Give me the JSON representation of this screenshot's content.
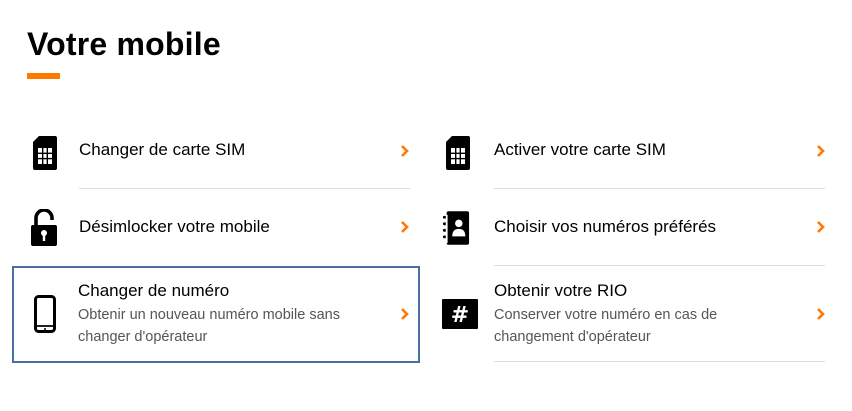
{
  "page": {
    "title": "Votre mobile"
  },
  "colors": {
    "accent": "#ff7900",
    "focus": "#4a6fa5"
  },
  "items": [
    {
      "label": "Changer de carte SIM",
      "icon": "sim-card-icon"
    },
    {
      "label": "Activer votre carte SIM",
      "icon": "sim-card-icon"
    },
    {
      "label": "Désimlocker votre mobile",
      "icon": "unlock-padlock-icon"
    },
    {
      "label": "Choisir vos numéros préférés",
      "icon": "contact-book-icon"
    },
    {
      "label": "Changer de numéro",
      "description": "Obtenir un nouveau numéro mobile sans changer d'opérateur",
      "icon": "smartphone-icon"
    },
    {
      "label": "Obtenir votre RIO",
      "description": "Conserver votre numéro en cas de changement d'opérateur",
      "icon": "hash-icon"
    }
  ]
}
